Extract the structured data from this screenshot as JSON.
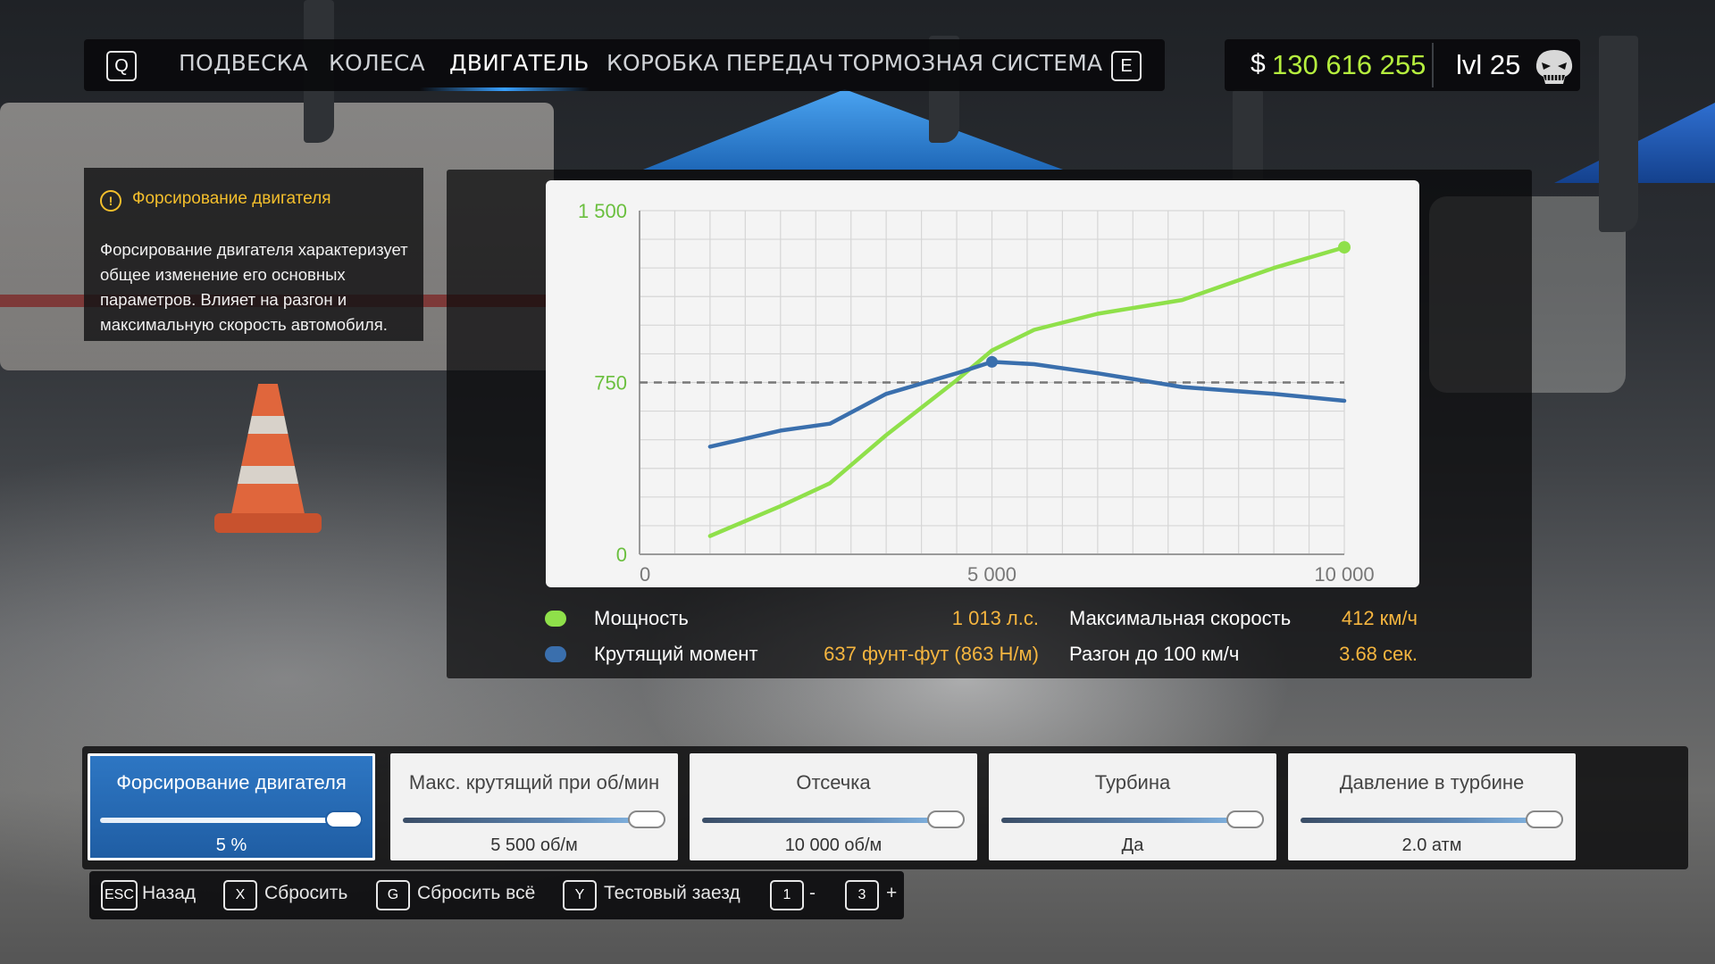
{
  "nav": {
    "left_key": "Q",
    "right_key": "E",
    "tabs": [
      {
        "label": "ПОДВЕСКА"
      },
      {
        "label": "КОЛЕСА"
      },
      {
        "label": "ДВИГАТЕЛЬ"
      },
      {
        "label": "КОРОБКА ПЕРЕДАЧ"
      },
      {
        "label": "ТОРМОЗНАЯ СИСТЕМА"
      }
    ],
    "active_tab": "ДВИГАТЕЛЬ"
  },
  "player": {
    "currency_symbol": "$",
    "money": "130 616 255",
    "level": "lvl 25",
    "avatar_icon": "skull-logo-icon"
  },
  "info": {
    "icon": "info-icon",
    "title": "Форсирование двигателя",
    "text": "Форсирование двигателя характеризует общее изменение его основных параметров. Влияет на разгон и максимальную скорость автомобиля."
  },
  "chart_data": {
    "type": "line",
    "x": [
      1000,
      2000,
      2700,
      3500,
      4500,
      5000,
      5600,
      6500,
      7700,
      9000,
      10000
    ],
    "series": [
      {
        "name": "Мощность",
        "color": "#8fe04a",
        "values": [
          80,
          210,
          310,
          520,
          760,
          890,
          980,
          1050,
          1110,
          1250,
          1340
        ]
      },
      {
        "name": "Крутящий момент",
        "color": "#3a6fad",
        "values": [
          470,
          540,
          570,
          700,
          790,
          840,
          830,
          790,
          730,
          700,
          670
        ]
      }
    ],
    "x_ticks": [
      "0",
      "5 000",
      "10 000"
    ],
    "y_ticks": [
      "0",
      "750",
      "1 500"
    ],
    "y_label_color": "#6abf3e",
    "xlim": [
      0,
      10000
    ],
    "ylim": [
      0,
      1500
    ],
    "reference_line": 750,
    "grid": true
  },
  "legend": [
    {
      "label": "Мощность",
      "value": "1 013 л.с.",
      "color": "#8fe04a"
    },
    {
      "label": "Крутящий момент",
      "value": "637 фунт-фут (863 Н/м)",
      "color": "#3a6fad"
    }
  ],
  "stats": [
    {
      "label": "Максимальная скорость",
      "value": "412 км/ч"
    },
    {
      "label": "Разгон до 100 км/ч",
      "value": "3.68 сек."
    }
  ],
  "sliders": [
    {
      "title": "Форсирование двигателя",
      "value": "5 %",
      "level": 1.0,
      "active": true
    },
    {
      "title": "Макс. крутящий при об/мин",
      "value": "5 500 об/м",
      "level": 1.0,
      "active": false
    },
    {
      "title": "Отсечка",
      "value": "10 000 об/м",
      "level": 1.0,
      "active": false
    },
    {
      "title": "Турбина",
      "value": "Да",
      "level": 1.0,
      "active": false
    },
    {
      "title": "Давление в турбине",
      "value": "2.0 атм",
      "level": 1.0,
      "active": false
    }
  ],
  "hints": [
    {
      "key": "ESC",
      "label": "Назад"
    },
    {
      "key": "X",
      "label": "Сбросить"
    },
    {
      "key": "G",
      "label": "Сбросить всё"
    },
    {
      "key": "Y",
      "label": "Тестовый заезд"
    },
    {
      "key": "1",
      "label": "-"
    },
    {
      "key": "3",
      "label": "+"
    }
  ]
}
